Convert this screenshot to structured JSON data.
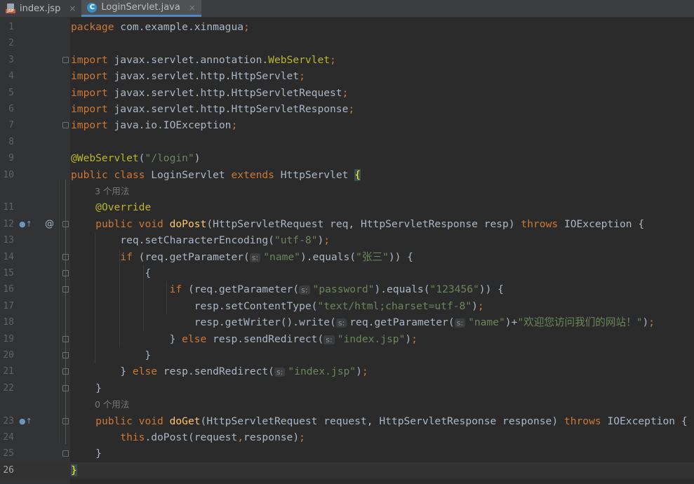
{
  "tabs": [
    {
      "label": "index.jsp",
      "icon": "jsp-file-icon",
      "active": false,
      "close": "×"
    },
    {
      "label": "LoginServlet.java",
      "icon": "java-class-icon",
      "active": true,
      "close": "×"
    }
  ],
  "icon_badges": {
    "jsp": "JSP",
    "class": "C"
  },
  "current_line": 26,
  "gutter_marks": {
    "override": "●↑",
    "at": "@"
  },
  "lines": [
    {
      "n": "1",
      "tokens": [
        [
          "kw",
          "package"
        ],
        [
          "id",
          " com.example.xinmagua"
        ],
        [
          "kw",
          ";"
        ]
      ]
    },
    {
      "n": "2",
      "tokens": []
    },
    {
      "n": "3",
      "tokens": [
        [
          "kw",
          "import"
        ],
        [
          "id",
          " javax.servlet.annotation."
        ],
        [
          "ann",
          "WebServlet"
        ],
        [
          "kw",
          ";"
        ]
      ]
    },
    {
      "n": "4",
      "tokens": [
        [
          "kw",
          "import"
        ],
        [
          "id",
          " javax.servlet.http.HttpServlet"
        ],
        [
          "kw",
          ";"
        ]
      ]
    },
    {
      "n": "5",
      "tokens": [
        [
          "kw",
          "import"
        ],
        [
          "id",
          " javax.servlet.http.HttpServletRequest"
        ],
        [
          "kw",
          ";"
        ]
      ]
    },
    {
      "n": "6",
      "tokens": [
        [
          "kw",
          "import"
        ],
        [
          "id",
          " javax.servlet.http.HttpServletResponse"
        ],
        [
          "kw",
          ";"
        ]
      ]
    },
    {
      "n": "7",
      "tokens": [
        [
          "kw",
          "import"
        ],
        [
          "id",
          " java.io.IOException"
        ],
        [
          "kw",
          ";"
        ]
      ]
    },
    {
      "n": "8",
      "tokens": []
    },
    {
      "n": "9",
      "tokens": [
        [
          "ann",
          "@WebServlet"
        ],
        [
          "id",
          "("
        ],
        [
          "str",
          "\"/login\""
        ],
        [
          "id",
          ")"
        ]
      ]
    },
    {
      "n": "10",
      "tokens": [
        [
          "kw",
          "public class "
        ],
        [
          "id",
          "LoginServlet "
        ],
        [
          "kw",
          "extends "
        ],
        [
          "id",
          "HttpServlet "
        ],
        [
          "brace",
          "{"
        ]
      ]
    },
    {
      "n": "",
      "hint": "3 个用法"
    },
    {
      "n": "11",
      "tokens": [
        [
          "id",
          "    "
        ],
        [
          "ann",
          "@Override"
        ]
      ]
    },
    {
      "n": "12",
      "tokens": [
        [
          "id",
          "    "
        ],
        [
          "kw",
          "public void "
        ],
        [
          "fn",
          "doPost"
        ],
        [
          "id",
          "(HttpServletRequest req, HttpServletResponse resp) "
        ],
        [
          "kw",
          "throws "
        ],
        [
          "id",
          "IOException {"
        ]
      ]
    },
    {
      "n": "13",
      "tokens": [
        [
          "id",
          "        req.setCharacterEncoding("
        ],
        [
          "str",
          "\"utf-8\""
        ],
        [
          "id",
          ")"
        ],
        [
          "kw",
          ";"
        ]
      ]
    },
    {
      "n": "14",
      "tokens": [
        [
          "id",
          "        "
        ],
        [
          "kw",
          "if "
        ],
        [
          "id",
          "(req.getParameter("
        ],
        [
          "ph",
          "s:"
        ],
        [
          "str",
          "\"name\""
        ],
        [
          "id",
          ").equals("
        ],
        [
          "str",
          "\"张三\""
        ],
        [
          "id",
          ")) {"
        ]
      ]
    },
    {
      "n": "15",
      "tokens": [
        [
          "id",
          "            {"
        ]
      ]
    },
    {
      "n": "16",
      "tokens": [
        [
          "id",
          "                "
        ],
        [
          "kw",
          "if "
        ],
        [
          "id",
          "(req.getParameter("
        ],
        [
          "ph",
          "s:"
        ],
        [
          "str",
          "\"password\""
        ],
        [
          "id",
          ").equals("
        ],
        [
          "str",
          "\"123456\""
        ],
        [
          "id",
          ")) {"
        ]
      ]
    },
    {
      "n": "17",
      "tokens": [
        [
          "id",
          "                    resp.setContentType("
        ],
        [
          "str",
          "\"text/html;charset=utf-8\""
        ],
        [
          "id",
          ")"
        ],
        [
          "kw",
          ";"
        ]
      ]
    },
    {
      "n": "18",
      "tokens": [
        [
          "id",
          "                    resp.getWriter().write("
        ],
        [
          "ph",
          "s:"
        ],
        [
          "id",
          "req.getParameter("
        ],
        [
          "ph",
          "s:"
        ],
        [
          "str",
          "\"name\""
        ],
        [
          "id",
          ")+"
        ],
        [
          "str",
          "\"欢迎您访问我们的网站！\""
        ],
        [
          "id",
          ")"
        ],
        [
          "kw",
          ";"
        ]
      ]
    },
    {
      "n": "19",
      "tokens": [
        [
          "id",
          "                } "
        ],
        [
          "kw",
          "else "
        ],
        [
          "id",
          "resp.sendRedirect("
        ],
        [
          "ph",
          "s:"
        ],
        [
          "str",
          "\"index.jsp\""
        ],
        [
          "id",
          ")"
        ],
        [
          "kw",
          ";"
        ]
      ]
    },
    {
      "n": "20",
      "tokens": [
        [
          "id",
          "            }"
        ]
      ]
    },
    {
      "n": "21",
      "tokens": [
        [
          "id",
          "        } "
        ],
        [
          "kw",
          "else "
        ],
        [
          "id",
          "resp.sendRedirect("
        ],
        [
          "ph",
          "s:"
        ],
        [
          "str",
          "\"index.jsp\""
        ],
        [
          "id",
          ")"
        ],
        [
          "kw",
          ";"
        ]
      ]
    },
    {
      "n": "22",
      "tokens": [
        [
          "id",
          "    }"
        ]
      ]
    },
    {
      "n": "",
      "hint": "0 个用法"
    },
    {
      "n": "23",
      "tokens": [
        [
          "id",
          "    "
        ],
        [
          "kw",
          "public void "
        ],
        [
          "fn",
          "doGet"
        ],
        [
          "id",
          "(HttpServletRequest request, HttpServletResponse response) "
        ],
        [
          "kw",
          "throws "
        ],
        [
          "id",
          "IOException {"
        ]
      ]
    },
    {
      "n": "24",
      "tokens": [
        [
          "id",
          "        "
        ],
        [
          "kw",
          "this"
        ],
        [
          "id",
          ".doPost(request"
        ],
        [
          "kw",
          ","
        ],
        [
          "id",
          "response)"
        ],
        [
          "kw",
          ";"
        ]
      ]
    },
    {
      "n": "25",
      "tokens": [
        [
          "id",
          "    }"
        ]
      ]
    },
    {
      "n": "26",
      "tokens": [
        [
          "brace",
          "}"
        ]
      ]
    }
  ],
  "colors": {
    "background": "#2b2b2b",
    "keyword": "#cc7832",
    "string": "#6a8759",
    "annotation": "#bbb529",
    "method": "#ffc66d",
    "text": "#a9b7c6"
  }
}
